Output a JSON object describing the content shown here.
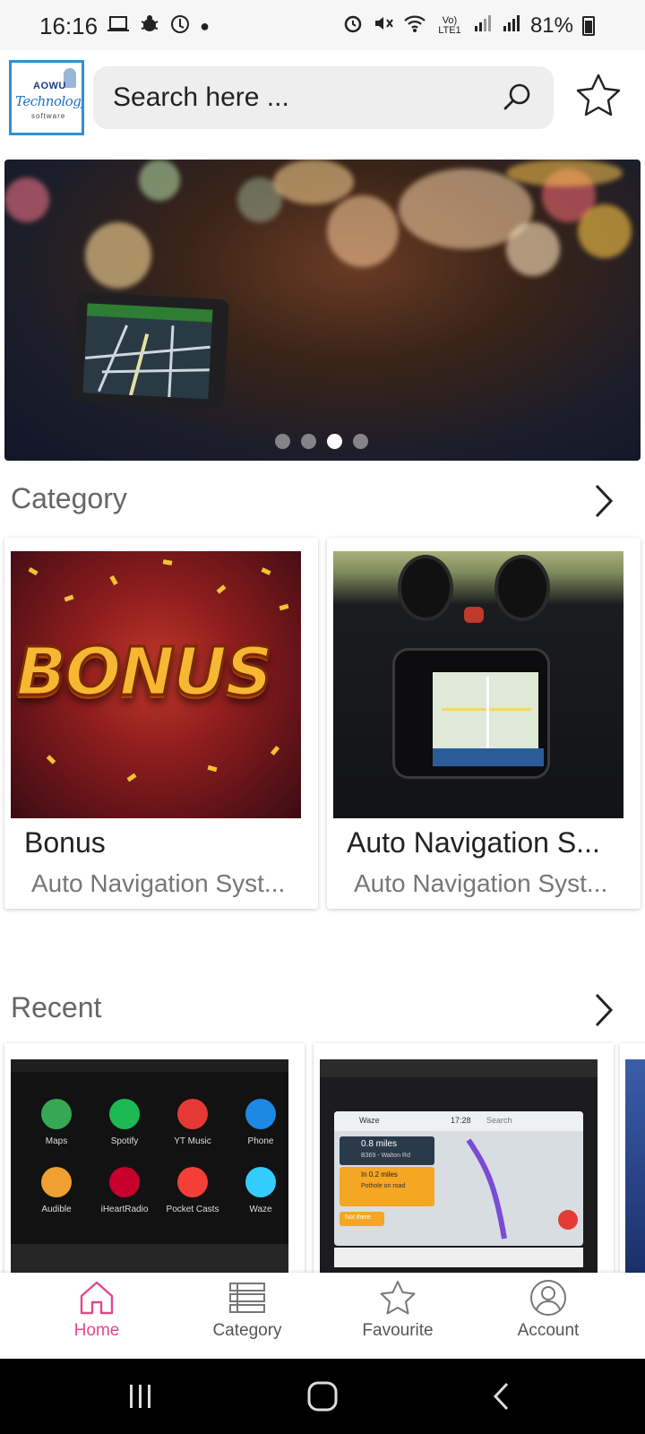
{
  "status_bar": {
    "time": "16:16",
    "signal_text": "Vo) LTE1",
    "battery": "81%"
  },
  "header": {
    "logo": {
      "line1": "AOWU",
      "line2": "Technology",
      "line3": "software"
    },
    "search": {
      "placeholder": "Search here ..."
    }
  },
  "banner": {
    "slide_count": 4,
    "active_slide": 3
  },
  "category_section": {
    "title": "Category",
    "cards": [
      {
        "title": "Bonus",
        "subtitle": "Auto Navigation Syst...",
        "image_text": "BONUS"
      },
      {
        "title": "Auto Navigation S...",
        "subtitle": "Auto Navigation Syst..."
      }
    ]
  },
  "recent_section": {
    "title": "Recent",
    "apps": [
      {
        "label": "Maps",
        "color": "#34a853"
      },
      {
        "label": "Spotify",
        "color": "#1db954"
      },
      {
        "label": "YT Music",
        "color": "#e53935"
      },
      {
        "label": "Phone",
        "color": "#1e88e5"
      },
      {
        "label": "Audible",
        "color": "#f0a030"
      },
      {
        "label": "iHeartRadio",
        "color": "#c6002b"
      },
      {
        "label": "Pocket Casts",
        "color": "#f43e37"
      },
      {
        "label": "Waze",
        "color": "#33ccff"
      }
    ],
    "waze": {
      "app": "Waze",
      "time": "17:28",
      "search": "Search",
      "distance1": "0.8 miles",
      "road1": "B369 - Walton Rd",
      "distance2": "In 0.2 miles",
      "road2": "Pothole on road",
      "action": "Not there"
    }
  },
  "bottom_nav": {
    "items": [
      {
        "label": "Home",
        "active": true
      },
      {
        "label": "Category",
        "active": false
      },
      {
        "label": "Favourite",
        "active": false
      },
      {
        "label": "Account",
        "active": false
      }
    ]
  },
  "colors": {
    "accent": "#e0498b",
    "search_bg": "#eeeeee",
    "logo_border": "#2f8fd8"
  }
}
